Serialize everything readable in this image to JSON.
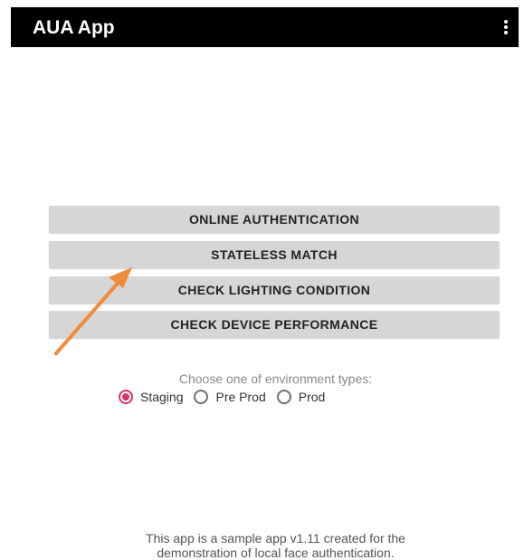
{
  "app_bar": {
    "title": "AUA App",
    "menu_icon": "more-vert-icon"
  },
  "buttons": [
    {
      "label": "ONLINE AUTHENTICATION"
    },
    {
      "label": "STATELESS MATCH"
    },
    {
      "label": "CHECK LIGHTING CONDITION"
    },
    {
      "label": "CHECK DEVICE PERFORMANCE"
    }
  ],
  "environment": {
    "prompt": "Choose one of environment types:",
    "options": [
      {
        "label": "Staging",
        "selected": true
      },
      {
        "label": "Pre Prod",
        "selected": false
      },
      {
        "label": "Prod",
        "selected": false
      }
    ],
    "accent_color": "#d6336c"
  },
  "annotation": {
    "icon": "arrow-icon",
    "color": "#f08a3c"
  },
  "footer": {
    "line1": "This app is a sample app v1.11 created for the",
    "line2": "demonstration of local face authentication."
  }
}
